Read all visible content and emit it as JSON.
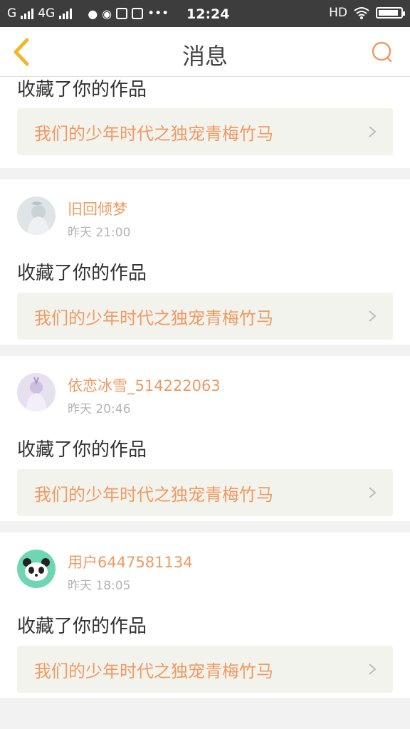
{
  "status_bar": {
    "carrier1": "G",
    "carrier2": "4G",
    "time": "12:24",
    "hd": "HD",
    "battery_level": 0.9
  },
  "nav": {
    "title": "消息",
    "back_icon": "chevron-left-icon",
    "search_icon": "search-icon",
    "accent_color": "#f0b830"
  },
  "accent_color": "#ef9a62",
  "messages": [
    {
      "action": "收藏了你的作品",
      "work_title": "我们的少年时代之独宠青梅竹马"
    },
    {
      "user": "旧回倾梦",
      "time": "昨天 21:00",
      "action": "收藏了你的作品",
      "work_title": "我们的少年时代之独宠青梅竹马"
    },
    {
      "user": "依恋冰雪_514222063",
      "time": "昨天 20:46",
      "action": "收藏了你的作品",
      "work_title": "我们的少年时代之独宠青梅竹马"
    },
    {
      "user": "用户6447581134",
      "time": "昨天 18:05",
      "action": "收藏了你的作品",
      "work_title": "我们的少年时代之独宠青梅竹马"
    }
  ]
}
